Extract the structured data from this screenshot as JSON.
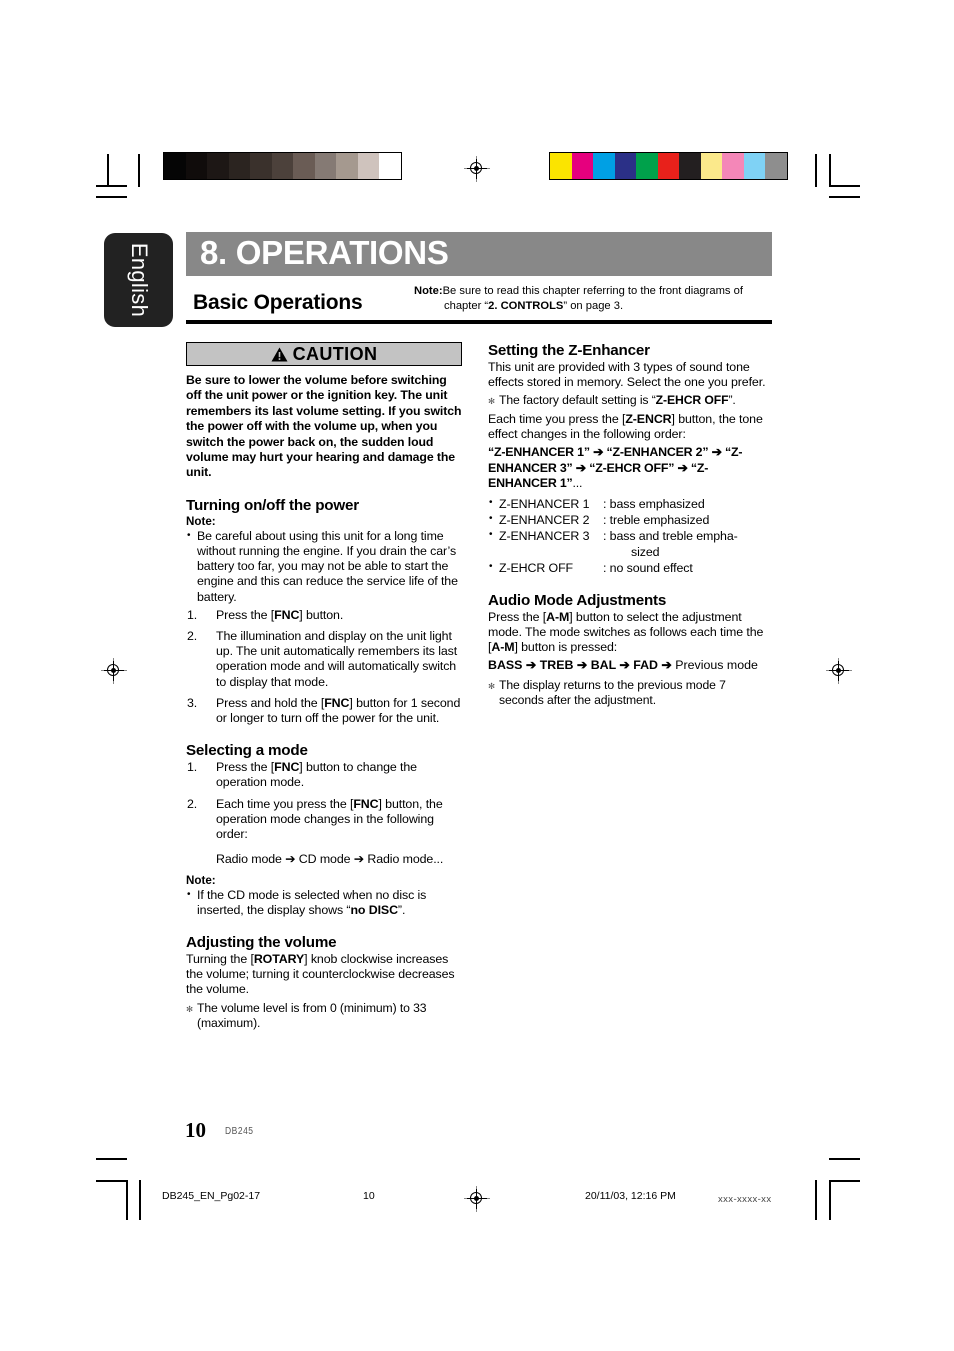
{
  "document": {
    "language_tab": "English",
    "chapter_title": "8. OPERATIONS",
    "section_title": "Basic Operations",
    "header_note": {
      "label": "Note:",
      "line1": "Be sure to read this chapter referring to the front diagrams of",
      "line2_pre": "chapter “",
      "line2_bold": "2. CONTROLS",
      "line2_post": "” on page 3."
    }
  },
  "caution": {
    "icon": "warning-triangle-icon",
    "label": "CAUTION",
    "text": "Be sure to lower the volume before switching off the unit power or the ignition key. The unit remembers its last volume setting. If you switch the power off with the volume up, when you switch the power back on, the sudden loud volume may hurt your hearing and damage the unit."
  },
  "left_column": {
    "power": {
      "heading": "Turning on/off the power",
      "note_label": "Note:",
      "notes": [
        "Be careful about using this unit for a long time without running the engine. If you drain the car’s battery too far, you may not be able to start the engine and this can reduce the service life of the battery."
      ],
      "steps": [
        {
          "pre": "Press the [",
          "bold": "FNC",
          "post": "] button."
        },
        {
          "pre": "The illumination and display on the unit light up. The unit automatically remembers its last operation mode and will automatically switch to display that mode.",
          "bold": "",
          "post": ""
        },
        {
          "pre": "Press and hold the [",
          "bold": "FNC",
          "post": "] button for 1 second or longer to turn off the power for the unit."
        }
      ]
    },
    "mode": {
      "heading": "Selecting a mode",
      "steps": [
        {
          "pre": "Press the [",
          "bold": "FNC",
          "post": "] button to change the operation mode."
        },
        {
          "pre": "Each time you press the [",
          "bold": "FNC",
          "post": "] button, the operation mode changes in the following order:"
        }
      ],
      "order_line": "Radio mode ➔ CD mode ➔ Radio mode...",
      "note_label": "Note:",
      "note_pre": "If the CD mode is selected when no disc is inserted, the display shows “",
      "note_bold": "no DISC",
      "note_post": "”."
    },
    "volume": {
      "heading": "Adjusting the volume",
      "body_pre": "Turning the [",
      "body_bold": "ROTARY",
      "body_post": "] knob clockwise increases the volume; turning it counterclockwise decreases the volume.",
      "notes": [
        "The volume level is from 0 (minimum) to 33 (maximum)."
      ]
    }
  },
  "right_column": {
    "z_enhancer": {
      "heading": "Setting the Z-Enhancer",
      "intro": "This unit are provided with 3 types of sound tone effects stored in memory. Select the one you prefer.",
      "default_note_pre": "The factory default setting is “",
      "default_note_bold": "Z-EHCR OFF",
      "default_note_post": "”.",
      "press_pre": "Each time you press the [",
      "press_bold": "Z-ENCR",
      "press_post": "] button, the tone effect changes in the following order:",
      "order_chain": "“Z-ENHANCER 1” ➔ “Z-ENHANCER 2” ➔ “Z-ENHANCER 3” ➔ “Z-EHCR OFF” ➔ “Z-ENHANCER 1”",
      "order_chain_tail": "...",
      "definitions": [
        {
          "term": "Z-ENHANCER 1",
          "desc": ": bass emphasized",
          "desc_cont": ""
        },
        {
          "term": "Z-ENHANCER 2",
          "desc": ": treble emphasized",
          "desc_cont": ""
        },
        {
          "term": "Z-ENHANCER 3",
          "desc": ": bass and treble empha-",
          "desc_cont": "sized"
        },
        {
          "term": "Z-EHCR OFF",
          "desc": ": no sound effect",
          "desc_cont": ""
        }
      ]
    },
    "audio_mode": {
      "heading": "Audio Mode Adjustments",
      "body_pre": "Press the [",
      "body_bold1": "A-M",
      "body_mid": "] button to select the adjustment mode. The mode switches as follows each time the [",
      "body_bold2": "A-M",
      "body_post": "] button is pressed:",
      "chain_bold": "BASS ➔ TREB ➔ BAL ➔ FAD ➔",
      "chain_normal": " Previous mode",
      "notes": [
        "The display returns to the previous mode 7 seconds after the adjustment."
      ]
    }
  },
  "footer": {
    "page_number": "10",
    "model_code": "DB245",
    "file_name": "DB245_EN_Pg02-17",
    "page_mark": "10",
    "timestamp": "20/11/03, 12:16 PM",
    "job_code": "xxx-xxxx-xx"
  },
  "print_marks": {
    "gray_bar_colors": [
      "#050505",
      "#100c0b",
      "#1d1715",
      "#2b2420",
      "#3a312c",
      "#4c413b",
      "#6a5c55",
      "#857a74",
      "#a5998f",
      "#cfc3bd",
      "#ffffff"
    ],
    "cmyk_bar_colors": [
      "#fbe400",
      "#e6007e",
      "#00a0e4",
      "#2b3087",
      "#00a14b",
      "#e8211b",
      "#231f20",
      "#fbe98b",
      "#f487b8",
      "#7fd2f5",
      "#8e8e8e"
    ]
  }
}
